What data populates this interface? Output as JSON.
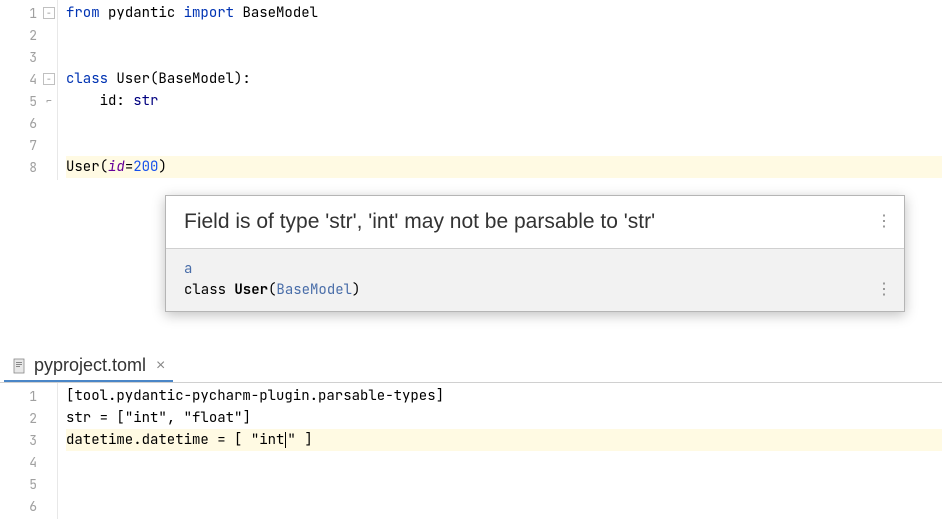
{
  "editor1": {
    "lines": [
      "1",
      "2",
      "3",
      "4",
      "5",
      "6",
      "7",
      "8"
    ],
    "code": {
      "l1_kw1": "from",
      "l1_mod": "pydantic",
      "l1_kw2": "import",
      "l1_cls": "BaseModel",
      "l4_kw": "class",
      "l4_name": "User",
      "l4_base": "BaseModel",
      "l5_field": "id",
      "l5_type": "str",
      "l8_call": "User",
      "l8_arg": "id",
      "l8_val": "200"
    }
  },
  "tooltip": {
    "title": "Field is of type 'str', 'int' may not be parsable to 'str'",
    "link": "a",
    "kw": "class ",
    "name": "User",
    "paren_open": "(",
    "param": "BaseModel",
    "paren_close": ")"
  },
  "tab": {
    "filename": "pyproject.toml"
  },
  "editor2": {
    "lines": [
      "1",
      "2",
      "3",
      "4",
      "5",
      "6"
    ],
    "code": {
      "l1": "[tool.pydantic-pycharm-plugin.parsable-types]",
      "l2_key": "str",
      "l2_eq": " = [",
      "l2_v1": "\"int\"",
      "l2_comma": ", ",
      "l2_v2": "\"float\"",
      "l2_close": "]",
      "l3_key": "datetime.datetime",
      "l3_eq": " = [ ",
      "l3_v1": "\"int",
      "l3_v1b": "\"",
      "l3_close": " ]"
    }
  }
}
